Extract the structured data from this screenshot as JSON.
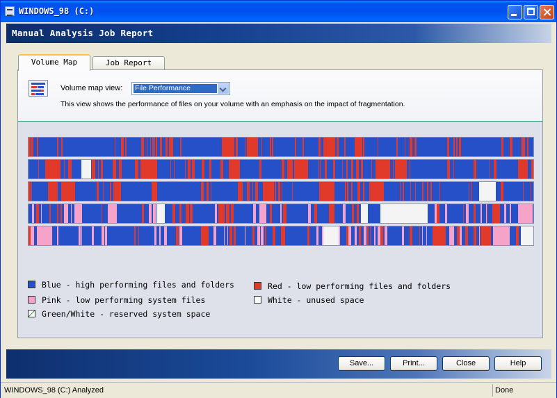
{
  "window": {
    "title": "WINDOWS_98 (C:)"
  },
  "banner": {
    "title": "Manual Analysis Job Report"
  },
  "tabs": [
    {
      "label": "Volume Map"
    },
    {
      "label": "Job Report"
    }
  ],
  "view": {
    "label": "Volume map view:",
    "selected": "File Performance",
    "description": "This view shows the performance of files on your volume with an emphasis on the impact of fragmentation."
  },
  "colors": {
    "blue": "#2550c8",
    "red": "#e23a2a",
    "pink": "#f6a3c9",
    "white": "#f4f4f4"
  },
  "legend": {
    "blue": "Blue - high performing files and folders",
    "red": "Red - low performing files and folders",
    "pink": "Pink - low performing system files",
    "white": "White - unused space",
    "green": "Green/White - reserved system space"
  },
  "buttons": [
    "Save...",
    "Print...",
    "Close",
    "Help"
  ],
  "status": {
    "left": "WINDOWS_98 (C:) Analyzed",
    "right": "Done"
  }
}
